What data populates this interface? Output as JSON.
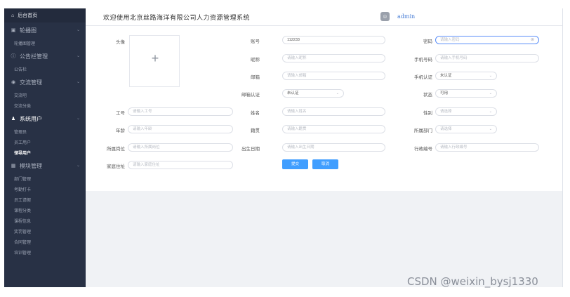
{
  "header": {
    "title": "欢迎使用北京丝路海洋有限公司人力资源管理系统",
    "username": "admin",
    "user_icon": "user-icon"
  },
  "sidebar": {
    "home": "后台首页",
    "groups": [
      {
        "label": "轮播图",
        "icon": "picture-icon",
        "items": [
          "轮播图管理"
        ]
      },
      {
        "label": "公告栏管理",
        "icon": "info-icon",
        "items": [
          "公告栏"
        ]
      },
      {
        "label": "交流管理",
        "icon": "chat-icon",
        "items": [
          "交流吧",
          "交流分类"
        ]
      },
      {
        "label": "系统用户",
        "icon": "user-icon",
        "items": [
          "管理员",
          "员工用户",
          "领导用户"
        ]
      },
      {
        "label": "模块管理",
        "icon": "grid-icon",
        "items": [
          "部门管理",
          "考勤打卡",
          "员工请假",
          "课程分类",
          "课程信息",
          "奖罚管理",
          "合同管理",
          "培训管理"
        ]
      }
    ],
    "active_item": "领导用户"
  },
  "form": {
    "avatar_label": "头像",
    "fields": {
      "account": {
        "label": "账号",
        "value": "112233"
      },
      "password": {
        "label": "密码",
        "placeholder": "请输入密码"
      },
      "nickname": {
        "label": "昵称",
        "placeholder": "请输入昵称"
      },
      "phone": {
        "label": "手机号码",
        "placeholder": "请输入手机号码"
      },
      "email": {
        "label": "邮箱",
        "placeholder": "请输入邮箱"
      },
      "phone_verify": {
        "label": "手机认证",
        "value": "未认证"
      },
      "email_verify": {
        "label": "邮箱认证",
        "value": "未认证"
      },
      "status": {
        "label": "状态",
        "value": "可用"
      },
      "job_no": {
        "label": "工号",
        "placeholder": "请输入工号"
      },
      "name": {
        "label": "姓名",
        "placeholder": "请输入姓名"
      },
      "gender": {
        "label": "性别",
        "placeholder": "请选择"
      },
      "age": {
        "label": "年龄",
        "placeholder": "请输入年龄"
      },
      "hometown": {
        "label": "籍贯",
        "placeholder": "请输入籍贯"
      },
      "department": {
        "label": "所属部门",
        "placeholder": "请选择"
      },
      "position": {
        "label": "所属岗位",
        "placeholder": "请输入所属岗位"
      },
      "birthday": {
        "label": "出生日期",
        "placeholder": "请输入出生日期"
      },
      "admin_no": {
        "label": "行政编号",
        "placeholder": "请输入行政编号"
      },
      "address": {
        "label": "家庭住址",
        "placeholder": "请输入家庭住址"
      }
    },
    "submit_label": "提交",
    "cancel_label": "取消"
  },
  "watermark": "CSDN @weixin_bysj1330",
  "colors": {
    "sidebar_bg": "#283145",
    "primary": "#409eff",
    "link": "#4a7fd6"
  }
}
